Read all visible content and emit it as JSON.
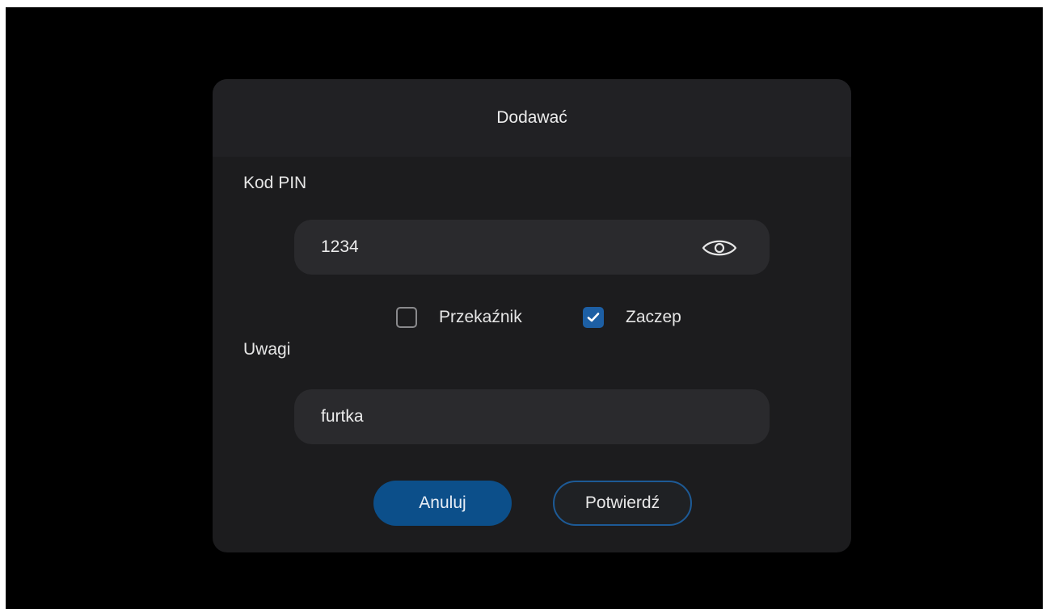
{
  "dialog": {
    "title": "Dodawać"
  },
  "pin": {
    "label": "Kod PIN",
    "value": "1234",
    "visibility_icon": "eye-icon"
  },
  "options": [
    {
      "label": "Przekaźnik",
      "checked": false
    },
    {
      "label": "Zaczep",
      "checked": true
    }
  ],
  "notes": {
    "label": "Uwagi",
    "value": "furtka"
  },
  "buttons": {
    "cancel": "Anuluj",
    "confirm": "Potwierdź"
  },
  "colors": {
    "accent": "#1d5fa4",
    "dialog_bg": "#1c1c1e",
    "input_bg": "#2a2a2d"
  }
}
